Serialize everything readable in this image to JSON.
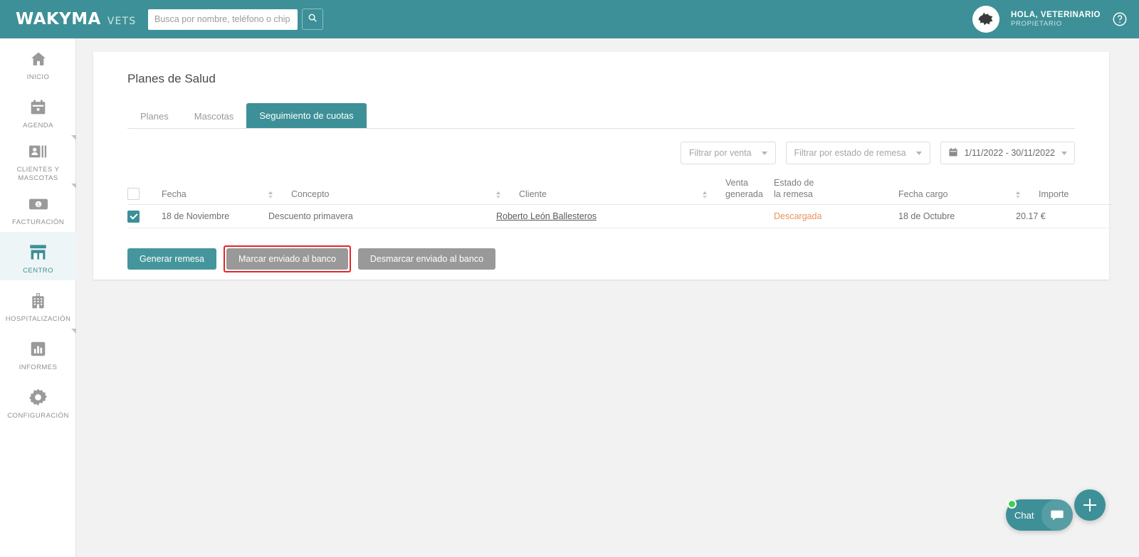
{
  "topbar": {
    "logo_main": "WAKYMA",
    "logo_sub": "VETS",
    "search_placeholder": "Busca por nombre, teléfono o chip",
    "search_value": "",
    "user_greeting": "HOLA, VETERINARIO",
    "user_role": "PROPIETARIO",
    "search_icon": "search-icon",
    "help_icon": "help-circle-icon",
    "avatar_icon": "dog-avatar-icon",
    "brand_color": "#3d9097"
  },
  "sidebar": {
    "items": [
      {
        "label": "INICIO",
        "icon": "home-icon",
        "active": false,
        "marker": false
      },
      {
        "label": "AGENDA",
        "icon": "calendar-icon",
        "active": false,
        "marker": false
      },
      {
        "label": "CLIENTES Y MASCOTAS",
        "icon": "contacts-icon",
        "active": false,
        "marker": true
      },
      {
        "label": "FACTURACIÓN",
        "icon": "banknote-icon",
        "active": false,
        "marker": true
      },
      {
        "label": "CENTRO",
        "icon": "store-icon",
        "active": true,
        "marker": false
      },
      {
        "label": "HOSPITALIZACIÓN",
        "icon": "hospital-icon",
        "active": false,
        "marker": false
      },
      {
        "label": "INFORMES",
        "icon": "bar-chart-icon",
        "active": false,
        "marker": true
      },
      {
        "label": "CONFIGURACIÓN",
        "icon": "gear-icon",
        "active": false,
        "marker": false
      }
    ]
  },
  "main": {
    "page_title": "Planes de Salud",
    "tabs": [
      {
        "label": "Planes",
        "active": false
      },
      {
        "label": "Mascotas",
        "active": false
      },
      {
        "label": "Seguimiento de cuotas",
        "active": true
      }
    ],
    "filters": {
      "venta_label": "Filtrar por venta",
      "remesa_label": "Filtrar por estado de remesa",
      "date_range": "1/11/2022 - 30/11/2022",
      "calendar_icon": "calendar-icon"
    },
    "table": {
      "select_all_checked": false,
      "columns": [
        {
          "key": "fecha",
          "label": "Fecha",
          "sortable": true
        },
        {
          "key": "concepto",
          "label": "Concepto",
          "sortable": true
        },
        {
          "key": "cliente",
          "label": "Cliente",
          "sortable": true
        },
        {
          "key": "venta",
          "label": "Venta generada",
          "sortable": false
        },
        {
          "key": "estado",
          "label_line1": "Estado de",
          "label_line2": "la remesa",
          "sortable": false
        },
        {
          "key": "fecha_cargo",
          "label": "Fecha cargo",
          "sortable": true
        },
        {
          "key": "importe",
          "label": "Importe",
          "sortable": true
        }
      ],
      "rows": [
        {
          "checked": true,
          "fecha": "18 de Noviembre",
          "concepto": "Descuento primavera",
          "cliente": "Roberto León Ballesteros",
          "venta": "",
          "estado": "Descargada",
          "estado_color": "#e8925b",
          "fecha_cargo": "18 de Octubre",
          "importe": "20.17 €"
        }
      ]
    },
    "actions": [
      {
        "label": "Generar remesa",
        "style": "primary",
        "highlighted": false
      },
      {
        "label": "Marcar enviado al banco",
        "style": "muted",
        "highlighted": true
      },
      {
        "label": "Desmarcar enviado al banco",
        "style": "muted",
        "highlighted": false
      }
    ],
    "highlight_color": "#e8222a"
  },
  "widgets": {
    "chat_label": "Chat",
    "chat_icon": "chat-bubble-icon",
    "chat_status": "online",
    "fab_icon": "plus-icon"
  }
}
